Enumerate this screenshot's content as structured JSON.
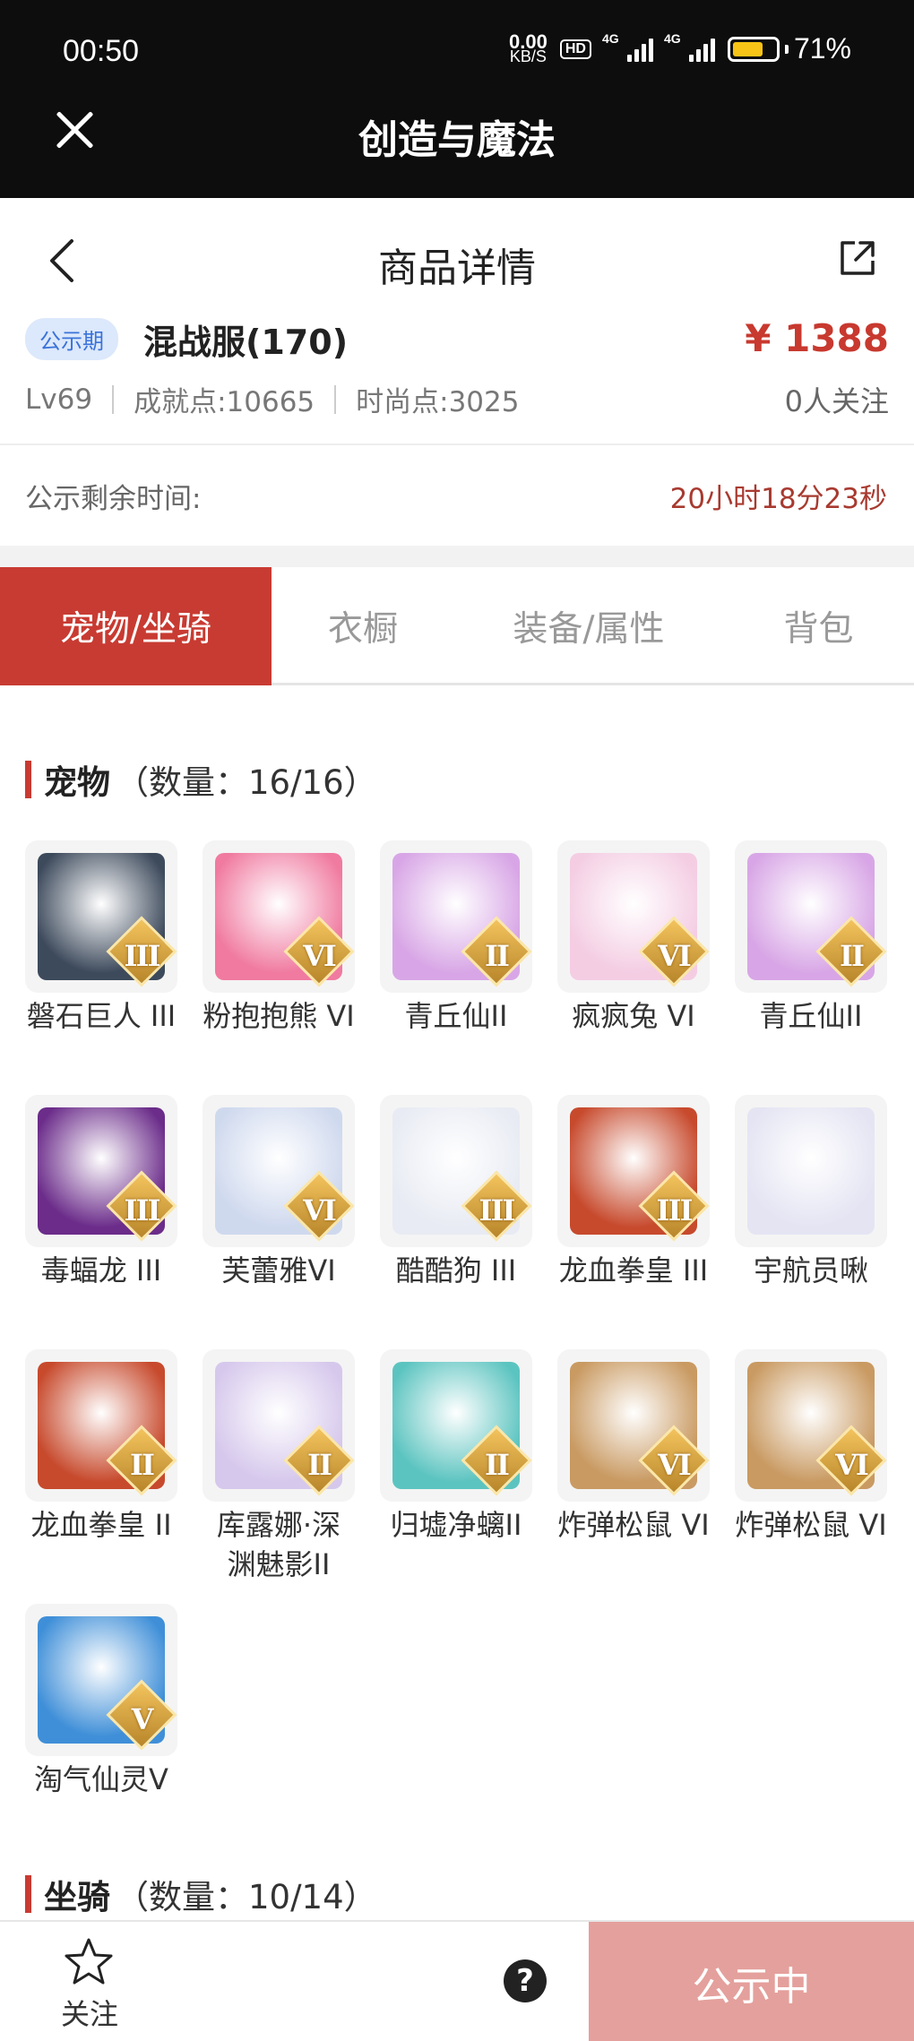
{
  "status_bar": {
    "time": "00:50",
    "net_speed_value": "0.00",
    "net_speed_unit": "KB/S",
    "hd_label": "HD",
    "signal1_label": "4G",
    "signal2_label": "4G",
    "battery_text": "71%"
  },
  "app": {
    "title": "创造与魔法"
  },
  "page": {
    "title": "商品详情"
  },
  "item": {
    "badge": "公示期",
    "server": "混战服(170)",
    "price": "¥ 1388",
    "level": "Lv69",
    "achievement": "成就点:10665",
    "fashion": "时尚点:3025",
    "followers": "0人关注"
  },
  "countdown": {
    "label": "公示剩余时间:",
    "value": "20小时18分23秒"
  },
  "tabs": [
    {
      "label": "宠物/坐骑",
      "active": true
    },
    {
      "label": "衣橱",
      "active": false
    },
    {
      "label": "装备/属性",
      "active": false
    },
    {
      "label": "背包",
      "active": false
    }
  ],
  "pets_section": {
    "title": "宠物",
    "count": "（数量：16/16）"
  },
  "pets": [
    {
      "name": "磐石巨人 III",
      "tier": "III",
      "color": "#3d4a5c"
    },
    {
      "name": "粉抱抱熊 VI",
      "tier": "VI",
      "color": "#f07aa0"
    },
    {
      "name": "青丘仙II",
      "tier": "II",
      "color": "#d8a6e6"
    },
    {
      "name": "疯疯兔 VI",
      "tier": "VI",
      "color": "#f4cde3"
    },
    {
      "name": "青丘仙II",
      "tier": "II",
      "color": "#d8a6e6"
    },
    {
      "name": "毒蝠龙 III",
      "tier": "III",
      "color": "#6b2c8a"
    },
    {
      "name": "芙蕾雅VI",
      "tier": "VI",
      "color": "#cfd9ee"
    },
    {
      "name": "酷酷狗 III",
      "tier": "III",
      "color": "#e8ebf3"
    },
    {
      "name": "龙血拳皇 III",
      "tier": "III",
      "color": "#c74a2d"
    },
    {
      "name": "宇航员啾",
      "tier": "",
      "color": "#e4e4f3"
    },
    {
      "name": "龙血拳皇 II",
      "tier": "II",
      "color": "#c74a2d"
    },
    {
      "name": "库露娜·深渊魅影II",
      "tier": "II",
      "color": "#d6c8ec"
    },
    {
      "name": "归墟净螭II",
      "tier": "II",
      "color": "#5cc4c0"
    },
    {
      "name": "炸弹松鼠 VI",
      "tier": "VI",
      "color": "#c99a62"
    },
    {
      "name": "炸弹松鼠 VI",
      "tier": "VI",
      "color": "#c99a62"
    },
    {
      "name": "淘气仙灵V",
      "tier": "V",
      "color": "#3f8fd8"
    }
  ],
  "mounts_section": {
    "title": "坐骑",
    "count": "（数量：10/14）"
  },
  "bottom": {
    "follow_label": "关注",
    "help_symbol": "?",
    "status_button": "公示中"
  }
}
